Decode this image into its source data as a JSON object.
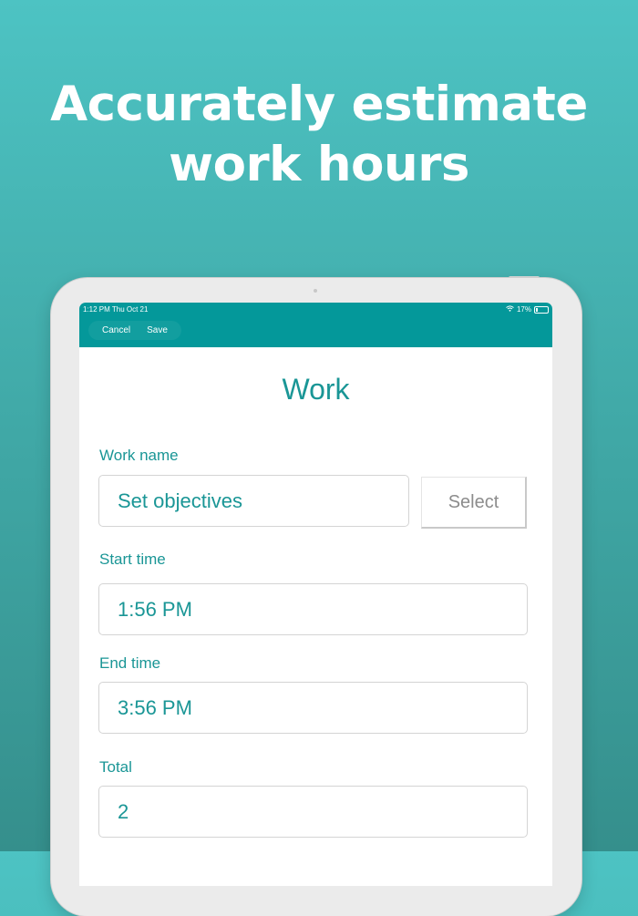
{
  "headline": {
    "line1": "Accurately estimate",
    "line2": "work hours"
  },
  "status_bar": {
    "time_date": "1:12 PM   Thu Oct 21",
    "battery": "17%",
    "icons": [
      "wifi-icon",
      "battery-icon"
    ]
  },
  "toolbar": {
    "cancel_label": "Cancel",
    "save_label": "Save"
  },
  "form": {
    "title": "Work",
    "work_name": {
      "label": "Work name",
      "value": "Set objectives",
      "select_label": "Select"
    },
    "start_time": {
      "label": "Start time",
      "value": "1:56 PM"
    },
    "end_time": {
      "label": "End time",
      "value": "3:56 PM"
    },
    "total": {
      "label": "Total",
      "value": "2"
    }
  },
  "colors": {
    "accent": "#04989a",
    "text_teal": "#1a9696",
    "background_top": "#4dc3c3",
    "background_bottom": "#358f8c"
  }
}
